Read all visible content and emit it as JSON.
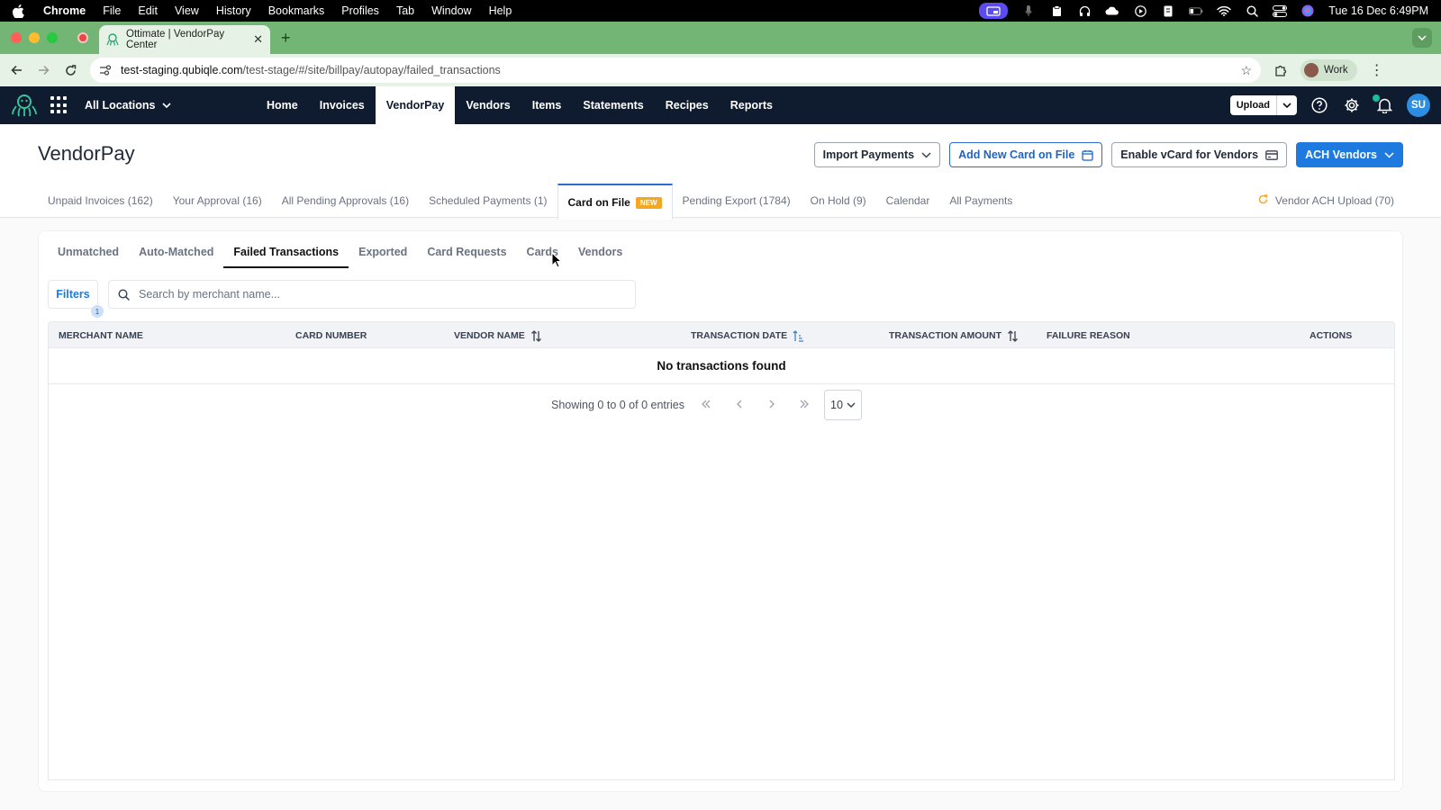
{
  "menubar": {
    "app": "Chrome",
    "items": [
      "File",
      "Edit",
      "View",
      "History",
      "Bookmarks",
      "Profiles",
      "Tab",
      "Window",
      "Help"
    ],
    "clock": "Tue 16 Dec  6:49PM"
  },
  "browser": {
    "tab_title": "Ottimate | VendorPay Center",
    "url_host": "test-staging.qubiqle.com",
    "url_path": "/test-stage/#/site/billpay/autopay/failed_transactions",
    "profile_label": "Work"
  },
  "appnav": {
    "location": "All Locations",
    "items": [
      "Home",
      "Invoices",
      "VendorPay",
      "Vendors",
      "Items",
      "Statements",
      "Recipes",
      "Reports"
    ],
    "active_item": "VendorPay",
    "upload_label": "Upload",
    "avatar_initials": "SU"
  },
  "page": {
    "title": "VendorPay",
    "actions": {
      "import": "Import Payments",
      "add_card": "Add New Card on File",
      "enable_vcard": "Enable vCard for Vendors",
      "ach": "ACH Vendors"
    },
    "subtabs": [
      "Unpaid Invoices (162)",
      "Your Approval (16)",
      "All Pending Approvals (16)",
      "Scheduled Payments (1)",
      "Card on File",
      "Pending Export (1784)",
      "On Hold (9)",
      "Calendar",
      "All Payments"
    ],
    "active_subtab": "Card on File",
    "new_badge": "NEW",
    "ach_upload": "Vendor ACH Upload (70)"
  },
  "card": {
    "tabs": [
      "Unmatched",
      "Auto-Matched",
      "Failed Transactions",
      "Exported",
      "Card Requests",
      "Cards",
      "Vendors"
    ],
    "active_tab": "Failed Transactions",
    "filters_label": "Filters",
    "filters_count": "1",
    "search_placeholder": "Search by merchant name...",
    "columns": [
      "MERCHANT NAME",
      "CARD NUMBER",
      "VENDOR NAME",
      "TRANSACTION DATE",
      "TRANSACTION AMOUNT",
      "FAILURE REASON",
      "ACTIONS"
    ],
    "empty_message": "No transactions found",
    "pager_info": "Showing 0 to 0 of 0 entries",
    "page_size": "10"
  },
  "colors": {
    "brand_navy": "#0f1b2e",
    "accent_blue": "#1f7ae0",
    "tabstrip_green": "#72b574",
    "new_badge": "#f5a623"
  }
}
